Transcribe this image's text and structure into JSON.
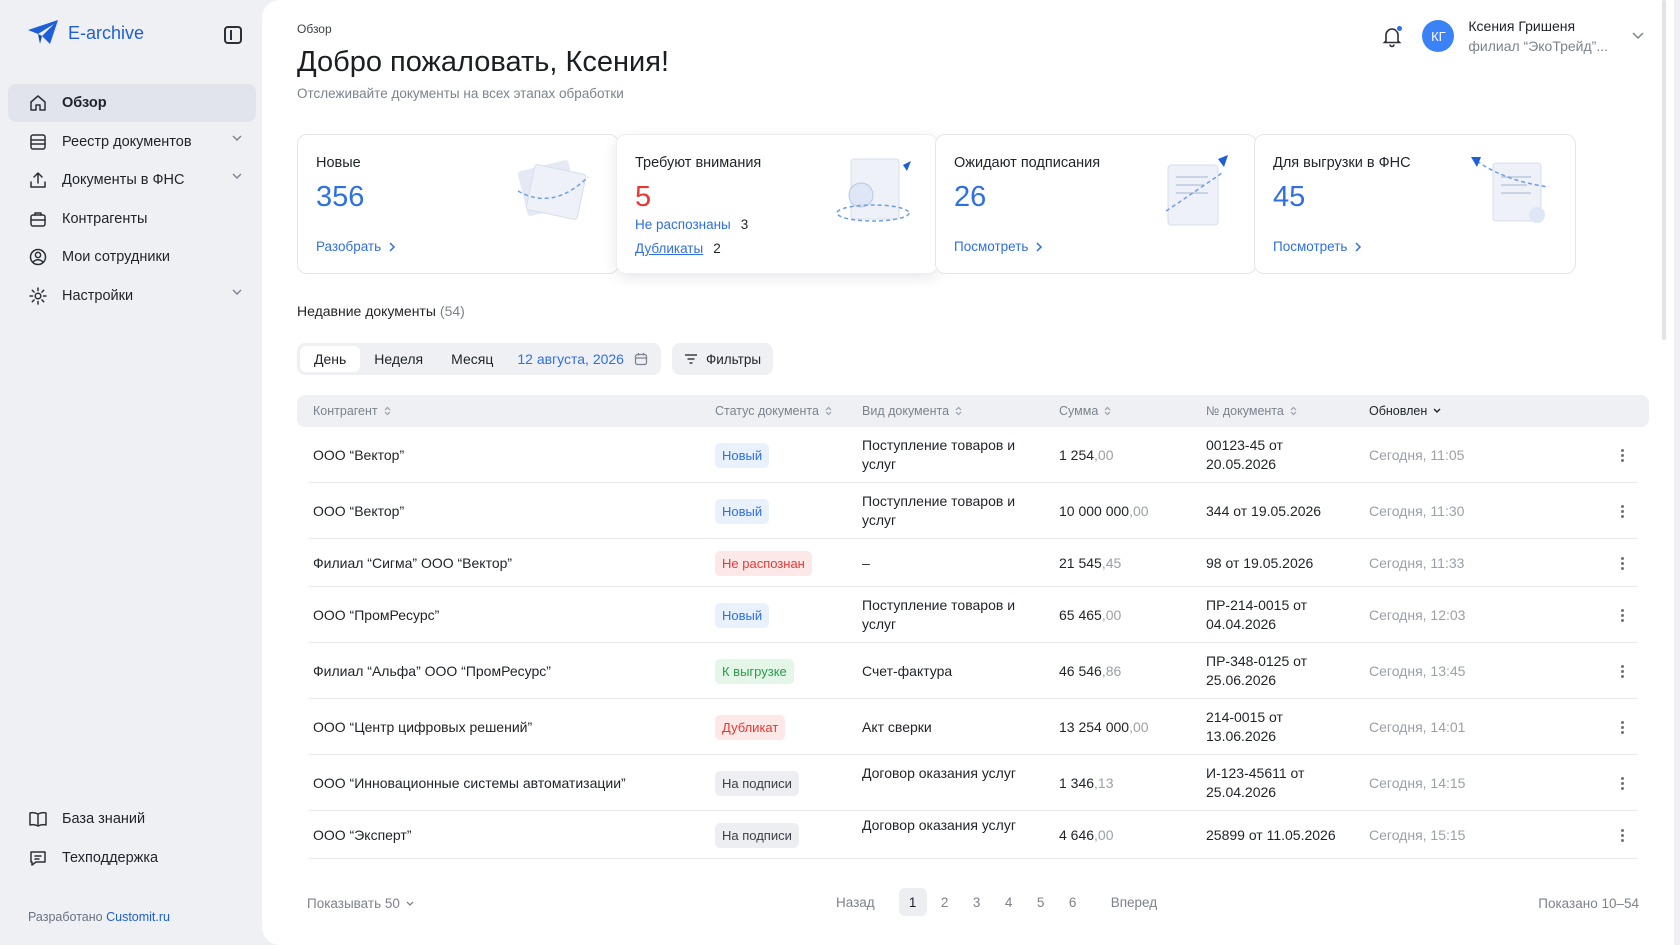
{
  "app": {
    "name": "E-archive",
    "brand_color": "#1e5fd9"
  },
  "sidebar": {
    "items": [
      {
        "label": "Обзор",
        "icon": "home-icon",
        "active": true
      },
      {
        "label": "Реестр документов",
        "icon": "registry-icon",
        "expandable": true
      },
      {
        "label": "Документы в ФНС",
        "icon": "upload-icon",
        "expandable": true
      },
      {
        "label": "Контрагенты",
        "icon": "briefcase-icon"
      },
      {
        "label": "Мои сотрудники",
        "icon": "user-circle-icon"
      },
      {
        "label": "Настройки",
        "icon": "gear-icon",
        "expandable": true
      }
    ],
    "bottom": [
      {
        "label": "База знаний",
        "icon": "book-icon"
      },
      {
        "label": "Техподдержка",
        "icon": "chat-icon"
      }
    ],
    "credit_prefix": "Разработано",
    "credit_link": "Customit.ru"
  },
  "header": {
    "breadcrumb": "Обзор",
    "title": "Добро пожаловать, Ксения!",
    "subtitle": "Отслеживайте документы на всех этапах обработки"
  },
  "user": {
    "initials": "КГ",
    "name": "Ксения Гришеня",
    "org": "филиал “ЭкоТрейд”..."
  },
  "cards": [
    {
      "title": "Новые",
      "value": "356",
      "link": "Разобрать"
    },
    {
      "title": "Требуют внимания",
      "value": "5",
      "sub": [
        {
          "label": "Не распознаны",
          "count": "3"
        },
        {
          "label": "Дубликаты",
          "count": "2"
        }
      ]
    },
    {
      "title": "Ожидают подписания",
      "value": "26",
      "link": "Посмотреть"
    },
    {
      "title": "Для выгрузки в ФНС",
      "value": "45",
      "link": "Посмотреть"
    }
  ],
  "recent": {
    "title": "Недавние документы",
    "count": "(54)",
    "periods": [
      "День",
      "Неделя",
      "Месяц"
    ],
    "date": "12 августа, 2026",
    "filters": "Фильтры",
    "columns": [
      "Контрагент",
      "Статус документа",
      "Вид документа",
      "Сумма",
      "№ документа",
      "Обновлен"
    ],
    "rows": [
      {
        "party": "ООО “Вектор”",
        "status": "Новый",
        "kind": "new",
        "type": "Поступление товаров и услуг",
        "sum": "1 254",
        "dec": ",00",
        "num": "00123-45 от 20.05.2026",
        "updated": "Сегодня, 11:05"
      },
      {
        "party": "ООО “Вектор”",
        "status": "Новый",
        "kind": "new",
        "type": "Поступление товаров и услуг",
        "sum": "10 000 000",
        "dec": ",00",
        "num": "344 от 19.05.2026",
        "updated": "Сегодня, 11:30"
      },
      {
        "party": "Филиал “Сигма” ООО “Вектор”",
        "status": "Не распознан",
        "kind": "err",
        "type": "–",
        "sum": "21 545",
        "dec": ",45",
        "num": "98 от 19.05.2026",
        "updated": "Сегодня, 11:33"
      },
      {
        "party": "ООО “ПромРесурс”",
        "status": "Новый",
        "kind": "new",
        "type": "Поступление товаров и услуг",
        "sum": "65 465",
        "dec": ",00",
        "num": "ПР-214-0015 от 04.04.2026",
        "updated": "Сегодня, 12:03"
      },
      {
        "party": "Филиал “Альфа” ООО “ПромРесурс”",
        "status": "К выгрузке",
        "kind": "ok",
        "type": "Счет-фактура",
        "sum": "46 546",
        "dec": ",86",
        "num": "ПР-348-0125 от 25.06.2026",
        "updated": "Сегодня, 13:45"
      },
      {
        "party": "ООО “Центр цифровых решений”",
        "status": "Дубликат",
        "kind": "err",
        "type": "Акт сверки",
        "sum": "13 254 000",
        "dec": ",00",
        "num": "214-0015 от 13.06.2026",
        "updated": "Сегодня, 14:01"
      },
      {
        "party": "ООО “Инновационные системы автоматизации”",
        "status": "На подписи",
        "kind": "sign",
        "type": "Договор оказания услуг",
        "sum": "1 346",
        "dec": ",13",
        "num": "И-123-45611 от 25.04.2026",
        "updated": "Сегодня, 14:15"
      },
      {
        "party": "ООО “Эксперт”",
        "status": "На подписи",
        "kind": "sign",
        "type": "Договор оказания услуг",
        "sum": "4 646",
        "dec": ",00",
        "num": "25899 от 11.05.2026",
        "updated": "Сегодня, 15:15"
      }
    ]
  },
  "pagination": {
    "per_page": "Показывать 50",
    "prev": "Назад",
    "next": "Вперед",
    "pages": [
      "1",
      "2",
      "3",
      "4",
      "5",
      "6"
    ],
    "current": "1",
    "shown": "Показано 10–54"
  }
}
